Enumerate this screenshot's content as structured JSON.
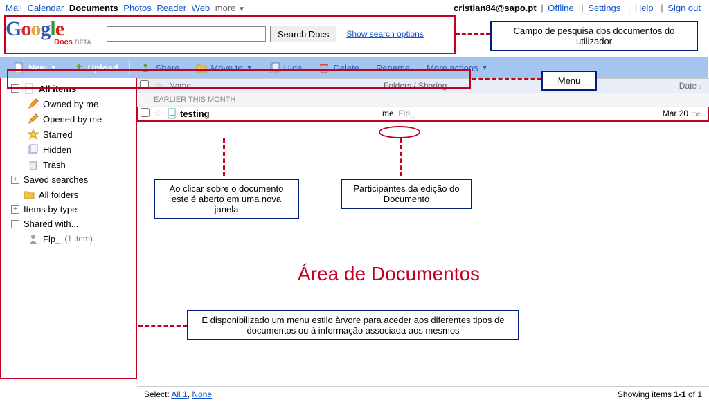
{
  "topnav": {
    "left": [
      "Mail",
      "Calendar",
      "Documents",
      "Photos",
      "Reader",
      "Web"
    ],
    "more": "more",
    "active_index": 2
  },
  "account": {
    "email": "cristian84@sapo.pt",
    "links": [
      "Offline",
      "Settings",
      "Help",
      "Sign out"
    ]
  },
  "logo": {
    "docs": "Docs",
    "beta": "BETA"
  },
  "search": {
    "value": "",
    "button": "Search Docs",
    "options": "Show search options"
  },
  "toolbar": {
    "new": "New",
    "upload": "Upload",
    "share": "Share",
    "moveto": "Move to",
    "hide": "Hide",
    "delete": "Delete",
    "rename": "Rename",
    "more": "More actions"
  },
  "sidebar": {
    "allitems": "All items",
    "owned": "Owned by me",
    "opened": "Opened by me",
    "starred": "Starred",
    "hidden": "Hidden",
    "trash": "Trash",
    "saved": "Saved searches",
    "allfolders": "All folders",
    "bytype": "Items by type",
    "shared": "Shared with...",
    "shared_user": "Flp_",
    "shared_count": "(1 item)"
  },
  "columns": {
    "name": "Name",
    "folders": "Folders / Sharing",
    "date": "Date"
  },
  "group_header": "EARLIER THIS MONTH",
  "doc": {
    "name": "testing",
    "sharing_me": "me",
    "sharing_other": ", Flp_",
    "date": "Mar 20",
    "date_me": "me"
  },
  "footer": {
    "select": "Select:",
    "all": "All 1",
    "none": "None",
    "showing_a": "Showing items ",
    "showing_b": "1-1",
    "showing_c": " of 1"
  },
  "annotations": {
    "search_box": "Campo de pesquisa dos documentos do utilizador",
    "menu": "Menu",
    "doc_click": "Ao clicar sobre o documento este é aberto em uma nova janela",
    "participants": "Participantes da edição do Documento",
    "area_title": "Área de Documentos",
    "tree_info": "É disponibilizado um menu estilo àrvore para aceder aos diferentes tipos de documentos ou à informação associada aos mesmos"
  }
}
